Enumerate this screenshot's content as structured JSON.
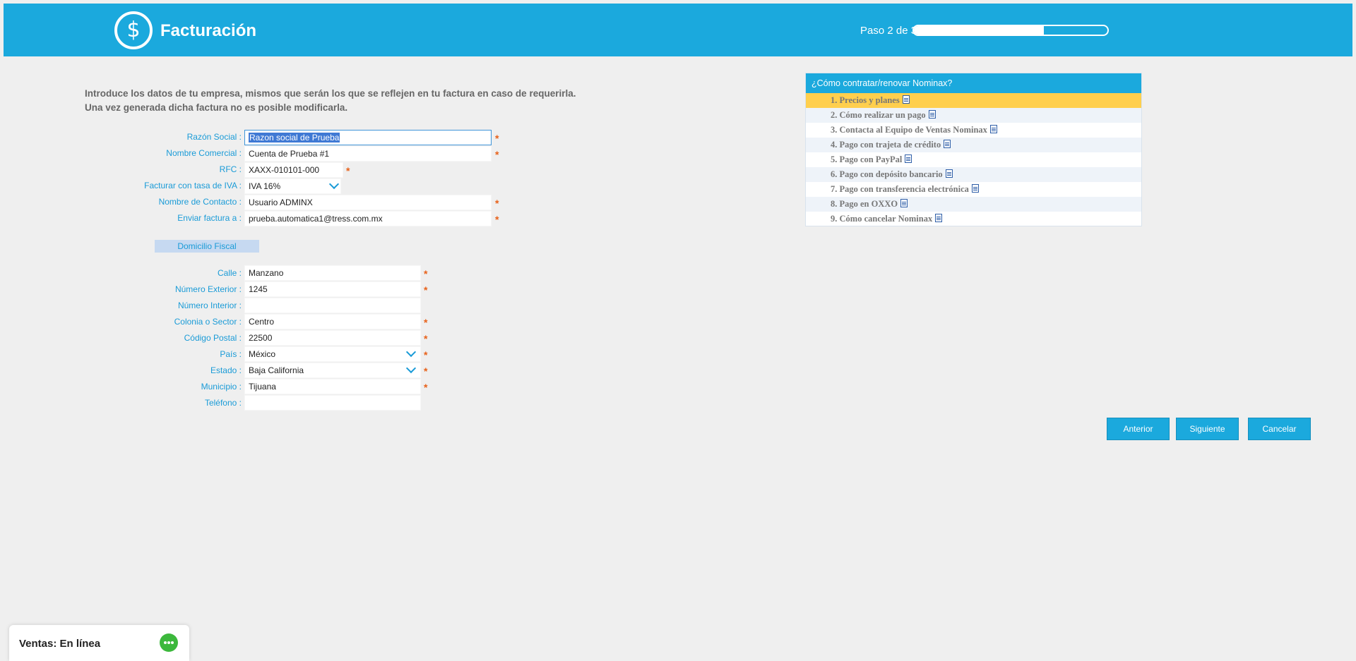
{
  "header": {
    "icon": "dollar-icon",
    "icon_glyph": "$",
    "title": "Facturación",
    "step_text": "Paso 2 de 3",
    "progress_fraction": 0.67
  },
  "intro": {
    "line1": "Introduce los datos de tu empresa, mismos que serán los que se reflejen en tu factura en caso de requerirla.",
    "line2": "Una vez generada dicha factura no es posible modificarla."
  },
  "company": {
    "razon_social": {
      "label": "Razón Social :",
      "value": "Razon social de Prueba"
    },
    "nombre_comercial": {
      "label": "Nombre Comercial :",
      "value": "Cuenta de Prueba #1"
    },
    "rfc": {
      "label": "RFC :",
      "value": "XAXX-010101-000"
    },
    "iva": {
      "label": "Facturar con tasa de IVA :",
      "value": "IVA 16%"
    },
    "contacto": {
      "label": "Nombre de Contacto :",
      "value": "Usuario ADMINX"
    },
    "enviar": {
      "label": "Enviar factura a :",
      "value": "prueba.automatica1@tress.com.mx"
    }
  },
  "required_mark": "*",
  "domicilio": {
    "title": "Domicilio Fiscal",
    "calle": {
      "label": "Calle :",
      "value": "Manzano"
    },
    "num_ext": {
      "label": "Número Exterior :",
      "value": "1245"
    },
    "num_int": {
      "label": "Número Interior :",
      "value": ""
    },
    "colonia": {
      "label": "Colonia o Sector :",
      "value": "Centro"
    },
    "cp": {
      "label": "Código Postal :",
      "value": "22500"
    },
    "pais": {
      "label": "País :",
      "value": "México"
    },
    "estado": {
      "label": "Estado :",
      "value": "Baja California"
    },
    "municipio": {
      "label": "Municipio :",
      "value": "Tijuana"
    },
    "telefono": {
      "label": "Teléfono :",
      "value": ""
    }
  },
  "help": {
    "title": "¿Cómo contratar/renovar Nominax?",
    "items": [
      "1. Precios y planes",
      "2. Cómo realizar un pago",
      "3. Contacta al Equipo de Ventas Nominax",
      "4. Pago con trajeta de crédito",
      "5. Pago con PayPal",
      "6. Pago con depósito bancario",
      "7. Pago con transferencia electrónica",
      "8. Pago en OXXO",
      "9. Cómo cancelar Nominax"
    ]
  },
  "buttons": {
    "anterior": "Anterior",
    "siguiente": "Siguiente",
    "cancelar": "Cancelar"
  },
  "chat": {
    "label": "Ventas: En línea",
    "icon": "chat-bubble-icon"
  },
  "colors": {
    "brand": "#1ba9dd",
    "label": "#1a9bd7",
    "required": "#e8611a",
    "highlight": "#ffcf4d",
    "chat": "#3cb83c"
  }
}
